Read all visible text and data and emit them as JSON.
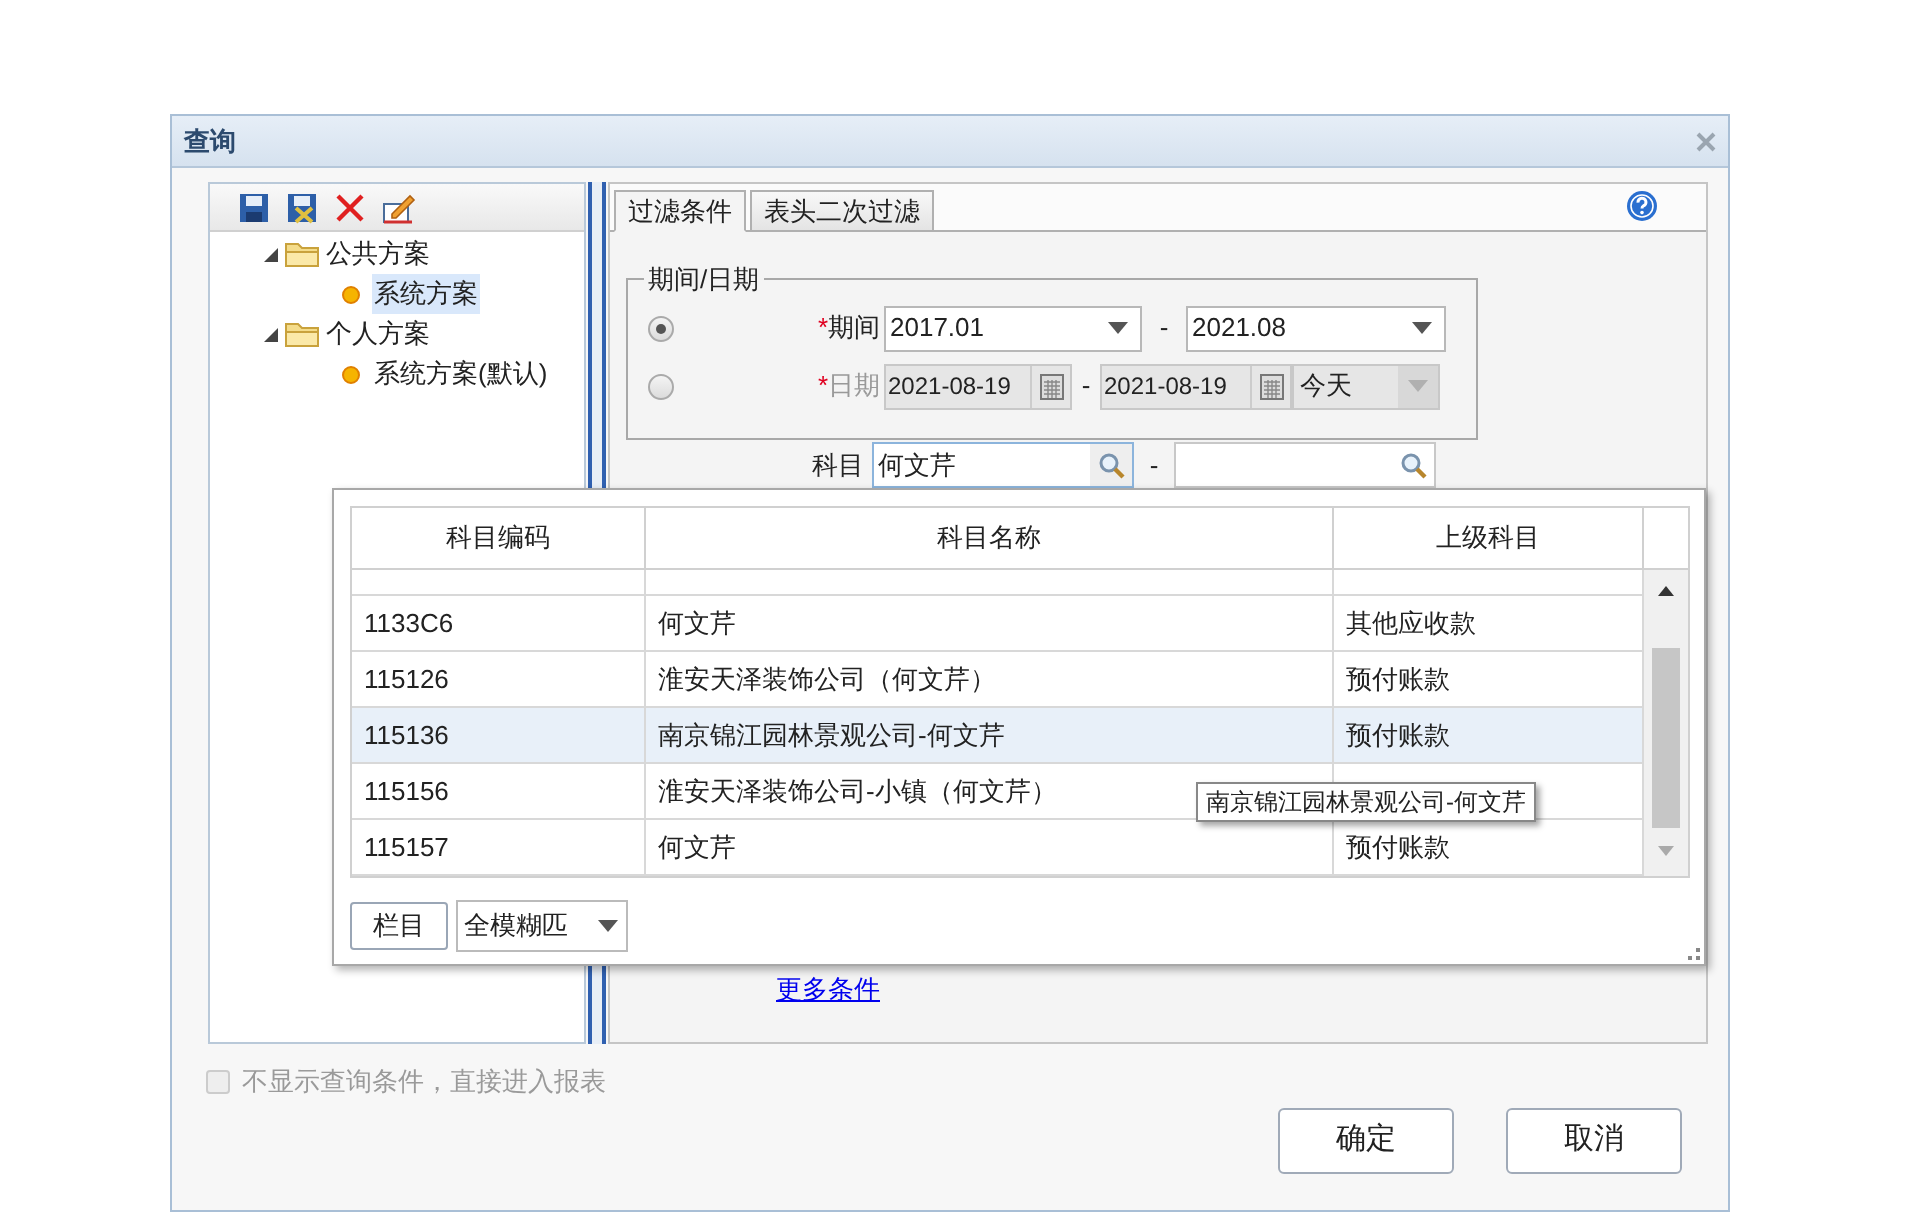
{
  "window": {
    "title": "查询"
  },
  "tree": [
    {
      "label": "公共方案",
      "expanded": true,
      "children": [
        {
          "label": "系统方案",
          "selected": true
        }
      ]
    },
    {
      "label": "个人方案",
      "expanded": true,
      "children": [
        {
          "label": "系统方案(默认)",
          "selected": false
        }
      ]
    }
  ],
  "tabs": [
    {
      "label": "过滤条件",
      "selected": true
    },
    {
      "label": "表头二次过滤",
      "selected": false
    }
  ],
  "period_group": {
    "title": "期间/日期",
    "options": [
      {
        "kind": "period",
        "selected": true,
        "disabled": false,
        "marker": "*",
        "label": "期间",
        "from": "2017.01",
        "separator": "-",
        "to": "2021.08"
      },
      {
        "kind": "date",
        "selected": false,
        "disabled": true,
        "marker": "*",
        "label": "日期",
        "from": "2021-08-19",
        "separator": "-",
        "to": "2021-08-19",
        "preset": "今天"
      }
    ]
  },
  "subject": {
    "label": "科目",
    "value": "何文芹",
    "separator": "-"
  },
  "popup": {
    "columns": [
      "科目编码",
      "科目名称",
      "上级科目"
    ],
    "rows": [
      {
        "code": "1133C6",
        "name": "何文芹",
        "parent": "其他应收款",
        "selected": false
      },
      {
        "code": "115126",
        "name": "淮安天泽装饰公司（何文芹）",
        "parent": "预付账款",
        "selected": false
      },
      {
        "code": "115136",
        "name": "南京锦江园林景观公司-何文芹",
        "parent": "预付账款",
        "selected": true
      },
      {
        "code": "115156",
        "name": "淮安天泽装饰公司-小镇（何文芹）",
        "selected": false
      },
      {
        "code": "115157",
        "name": "何文芹",
        "parent": "预付账款",
        "selected": false
      }
    ],
    "columns_button": "栏目",
    "match_mode": "全模糊匹",
    "tooltip": "南京锦江园林景观公司-何文芹"
  },
  "more_link": "更多条件",
  "skip_checkbox": {
    "label": "不显示查询条件，直接进入报表",
    "checked": false,
    "disabled": true
  },
  "buttons": [
    "确定",
    "取消"
  ]
}
